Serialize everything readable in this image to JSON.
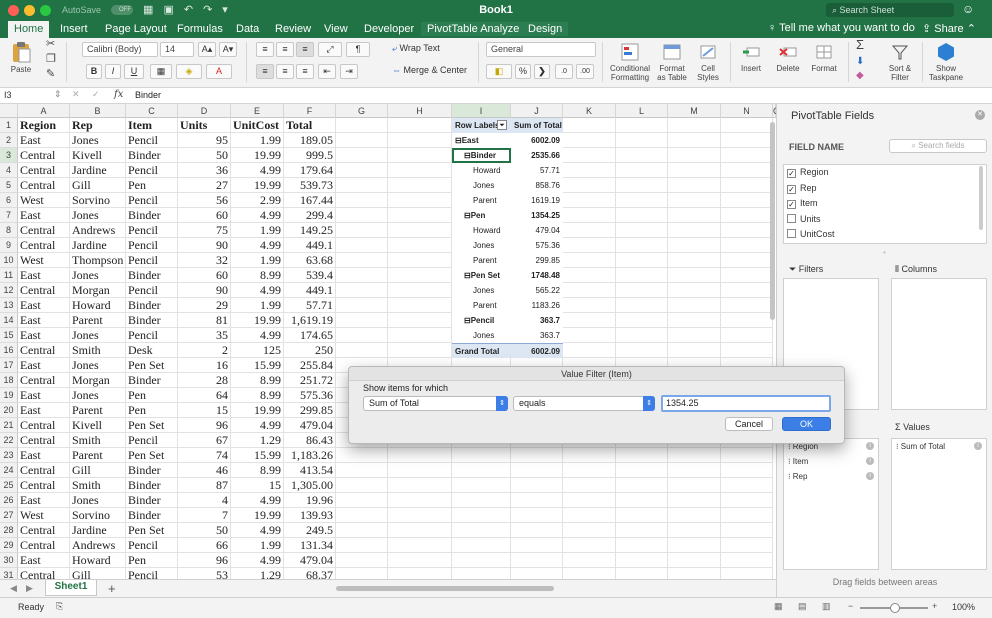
{
  "titlebar": {
    "autosave_label": "AutoSave",
    "autosave_state": "OFF",
    "doc_title": "Book1",
    "search_placeholder": "Search Sheet"
  },
  "ribbon_tabs": [
    "Home",
    "Insert",
    "Page Layout",
    "Formulas",
    "Data",
    "Review",
    "View",
    "Developer",
    "PivotTable Analyze",
    "Design"
  ],
  "tell_me": "Tell me what you want to do",
  "share_label": "Share",
  "ribbon": {
    "paste": "Paste",
    "font_name": "Calibri (Body)",
    "font_size": "14",
    "bold": "B",
    "italic": "I",
    "underline": "U",
    "wrap_text": "Wrap Text",
    "merge_center": "Merge & Center",
    "number_format": "General",
    "percent": "%",
    "comma": ",",
    "conditional_formatting": [
      "Conditional",
      "Formatting"
    ],
    "format_as_table": [
      "Format",
      "as Table"
    ],
    "cell_styles": [
      "Cell",
      "Styles"
    ],
    "insert": "Insert",
    "delete": "Delete",
    "format": "Format",
    "sort_filter": [
      "Sort &",
      "Filter"
    ],
    "show_taskpane": [
      "Show",
      "Taskpane"
    ]
  },
  "formula_bar": {
    "cell_ref": "I3",
    "fx": "fx",
    "value": "Binder"
  },
  "columns": [
    "A",
    "B",
    "C",
    "D",
    "E",
    "F",
    "G",
    "H",
    "I",
    "J",
    "K",
    "L",
    "M",
    "N",
    "O"
  ],
  "row_numbers": [
    "1",
    "2",
    "3",
    "4",
    "5",
    "6",
    "7",
    "8",
    "9",
    "10",
    "11",
    "12",
    "13",
    "14",
    "15",
    "16",
    "17",
    "18",
    "19",
    "20",
    "21",
    "22",
    "23",
    "24",
    "25",
    "26",
    "27",
    "28",
    "29",
    "30",
    "31"
  ],
  "table_headers": [
    "Region",
    "Rep",
    "Item",
    "Units",
    "UnitCost",
    "Total"
  ],
  "table_rows": [
    [
      "East",
      "Jones",
      "Pencil",
      "95",
      "1.99",
      "189.05"
    ],
    [
      "Central",
      "Kivell",
      "Binder",
      "50",
      "19.99",
      "999.5"
    ],
    [
      "Central",
      "Jardine",
      "Pencil",
      "36",
      "4.99",
      "179.64"
    ],
    [
      "Central",
      "Gill",
      "Pen",
      "27",
      "19.99",
      "539.73"
    ],
    [
      "West",
      "Sorvino",
      "Pencil",
      "56",
      "2.99",
      "167.44"
    ],
    [
      "East",
      "Jones",
      "Binder",
      "60",
      "4.99",
      "299.4"
    ],
    [
      "Central",
      "Andrews",
      "Pencil",
      "75",
      "1.99",
      "149.25"
    ],
    [
      "Central",
      "Jardine",
      "Pencil",
      "90",
      "4.99",
      "449.1"
    ],
    [
      "West",
      "Thompson",
      "Pencil",
      "32",
      "1.99",
      "63.68"
    ],
    [
      "East",
      "Jones",
      "Binder",
      "60",
      "8.99",
      "539.4"
    ],
    [
      "Central",
      "Morgan",
      "Pencil",
      "90",
      "4.99",
      "449.1"
    ],
    [
      "East",
      "Howard",
      "Binder",
      "29",
      "1.99",
      "57.71"
    ],
    [
      "East",
      "Parent",
      "Binder",
      "81",
      "19.99",
      "1,619.19"
    ],
    [
      "East",
      "Jones",
      "Pencil",
      "35",
      "4.99",
      "174.65"
    ],
    [
      "Central",
      "Smith",
      "Desk",
      "2",
      "125",
      "250"
    ],
    [
      "East",
      "Jones",
      "Pen Set",
      "16",
      "15.99",
      "255.84"
    ],
    [
      "Central",
      "Morgan",
      "Binder",
      "28",
      "8.99",
      "251.72"
    ],
    [
      "East",
      "Jones",
      "Pen",
      "64",
      "8.99",
      "575.36"
    ],
    [
      "East",
      "Parent",
      "Pen",
      "15",
      "19.99",
      "299.85"
    ],
    [
      "Central",
      "Kivell",
      "Pen Set",
      "96",
      "4.99",
      "479.04"
    ],
    [
      "Central",
      "Smith",
      "Pencil",
      "67",
      "1.29",
      "86.43"
    ],
    [
      "East",
      "Parent",
      "Pen Set",
      "74",
      "15.99",
      "1,183.26"
    ],
    [
      "Central",
      "Gill",
      "Binder",
      "46",
      "8.99",
      "413.54"
    ],
    [
      "Central",
      "Smith",
      "Binder",
      "87",
      "15",
      "1,305.00"
    ],
    [
      "East",
      "Jones",
      "Binder",
      "4",
      "4.99",
      "19.96"
    ],
    [
      "West",
      "Sorvino",
      "Binder",
      "7",
      "19.99",
      "139.93"
    ],
    [
      "Central",
      "Jardine",
      "Pen Set",
      "50",
      "4.99",
      "249.5"
    ],
    [
      "Central",
      "Andrews",
      "Pencil",
      "66",
      "1.99",
      "131.34"
    ],
    [
      "East",
      "Howard",
      "Pen",
      "96",
      "4.99",
      "479.04"
    ],
    [
      "Central",
      "Gill",
      "Pencil",
      "53",
      "1.29",
      "68.37"
    ]
  ],
  "pivot": {
    "header_labels": "Row Labels",
    "header_sum": "Sum of Total",
    "rows": [
      {
        "label": "East",
        "value": "6002.09",
        "level": 0,
        "bold": true,
        "toggle": "⊟"
      },
      {
        "label": "Binder",
        "value": "2535.66",
        "level": 1,
        "bold": true,
        "toggle": "⊟"
      },
      {
        "label": "Howard",
        "value": "57.71",
        "level": 2,
        "bold": false,
        "toggle": ""
      },
      {
        "label": "Jones",
        "value": "858.76",
        "level": 2,
        "bold": false,
        "toggle": ""
      },
      {
        "label": "Parent",
        "value": "1619.19",
        "level": 2,
        "bold": false,
        "toggle": ""
      },
      {
        "label": "Pen",
        "value": "1354.25",
        "level": 1,
        "bold": true,
        "toggle": "⊟"
      },
      {
        "label": "Howard",
        "value": "479.04",
        "level": 2,
        "bold": false,
        "toggle": ""
      },
      {
        "label": "Jones",
        "value": "575.36",
        "level": 2,
        "bold": false,
        "toggle": ""
      },
      {
        "label": "Parent",
        "value": "299.85",
        "level": 2,
        "bold": false,
        "toggle": ""
      },
      {
        "label": "Pen Set",
        "value": "1748.48",
        "level": 1,
        "bold": true,
        "toggle": "⊟"
      },
      {
        "label": "Jones",
        "value": "565.22",
        "level": 2,
        "bold": false,
        "toggle": ""
      },
      {
        "label": "Parent",
        "value": "1183.26",
        "level": 2,
        "bold": false,
        "toggle": ""
      },
      {
        "label": "Pencil",
        "value": "363.7",
        "level": 1,
        "bold": true,
        "toggle": "⊟"
      },
      {
        "label": "Jones",
        "value": "363.7",
        "level": 2,
        "bold": false,
        "toggle": ""
      }
    ],
    "grand_total_label": "Grand Total",
    "grand_total_value": "6002.09"
  },
  "sheet_tab": "Sheet1",
  "add_sheet": "+",
  "status": {
    "ready": "Ready",
    "zoom": "100%"
  },
  "pane": {
    "title": "PivotTable Fields",
    "field_name": "FIELD NAME",
    "search_placeholder": "Search fields",
    "fields": [
      {
        "name": "Region",
        "checked": true
      },
      {
        "name": "Rep",
        "checked": true
      },
      {
        "name": "Item",
        "checked": true
      },
      {
        "name": "Units",
        "checked": false
      },
      {
        "name": "UnitCost",
        "checked": false
      }
    ],
    "filters": "Filters",
    "columns": "Columns",
    "rows_items": [
      "Region",
      "Item",
      "Rep"
    ],
    "values_label": "Values",
    "values_items": [
      "Sum of Total"
    ],
    "drag_hint": "Drag fields between areas"
  },
  "dialog": {
    "title": "Value Filter (Item)",
    "show_label": "Show items for which",
    "field": "Sum of Total",
    "operator": "equals",
    "value": "1354.25",
    "cancel": "Cancel",
    "ok": "OK"
  },
  "colors": {
    "excel_green": "#217346",
    "pivot_header": "#dde6f3",
    "ok_blue": "#3b7fe6"
  }
}
